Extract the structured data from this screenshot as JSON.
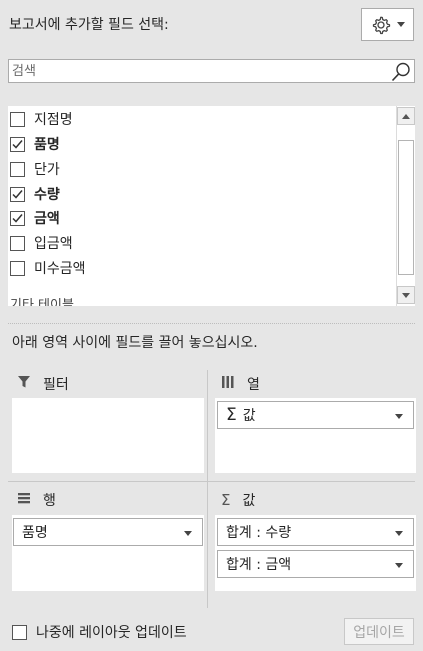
{
  "header": {
    "title": "보고서에 추가할 필드 선택:"
  },
  "search": {
    "placeholder": "검색"
  },
  "fields": [
    {
      "label": "지점명",
      "checked": false
    },
    {
      "label": "품명",
      "checked": true
    },
    {
      "label": "단가",
      "checked": false
    },
    {
      "label": "수량",
      "checked": true
    },
    {
      "label": "금액",
      "checked": true
    },
    {
      "label": "입금액",
      "checked": false
    },
    {
      "label": "미수금액",
      "checked": false
    }
  ],
  "field_group": {
    "label": "기타 테이블..."
  },
  "instruction": "아래 영역 사이에 필드를 끌어 놓으십시오.",
  "areas": {
    "filters": {
      "title": "필터"
    },
    "columns": {
      "title": "열",
      "items": [
        "값"
      ]
    },
    "rows": {
      "title": "행",
      "items": [
        "품명"
      ]
    },
    "values": {
      "title": "값",
      "items": [
        "합계 : 수량",
        "합계 : 금액"
      ]
    }
  },
  "footer": {
    "defer_label": "나중에 레이아웃 업데이트",
    "update_label": "업데이트"
  }
}
